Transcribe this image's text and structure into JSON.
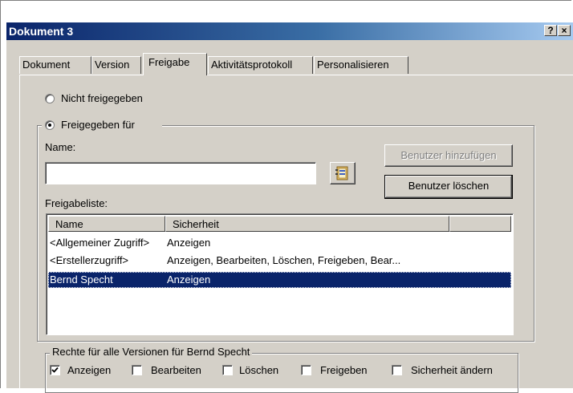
{
  "window": {
    "title": "Dokument 3",
    "help_button": "?",
    "close_button": "×"
  },
  "tabs": [
    {
      "label": "Dokument"
    },
    {
      "label": "Version"
    },
    {
      "label": "Freigabe",
      "active": true
    },
    {
      "label": "Aktivitätsprotokoll"
    },
    {
      "label": "Personalisieren"
    }
  ],
  "sharing": {
    "not_shared_label": "Nicht freigegeben",
    "shared_for_label": "Freigegeben für",
    "selected_option": "Freigegeben für",
    "name_label": "Name:",
    "name_value": "",
    "add_user_button": "Benutzer hinzufügen",
    "remove_user_button": "Benutzer löschen",
    "share_list_label": "Freigabeliste:",
    "list_columns": [
      "Name",
      "Sicherheit"
    ],
    "list_rows": [
      {
        "name": "<Allgemeiner Zugriff>",
        "security": "Anzeigen"
      },
      {
        "name": "<Erstellerzugriff>",
        "security": "Anzeigen, Bearbeiten, Löschen, Freigeben, Bear..."
      },
      {
        "name": "Bernd Specht",
        "security": "Anzeigen",
        "selected": true
      }
    ]
  },
  "rights": {
    "group_title": "Rechte für alle Versionen für Bernd Specht",
    "items": [
      {
        "label": "Anzeigen",
        "checked": true
      },
      {
        "label": "Bearbeiten",
        "checked": false
      },
      {
        "label": "Löschen",
        "checked": false
      },
      {
        "label": "Freigeben",
        "checked": false
      },
      {
        "label": "Sicherheit ändern",
        "checked": false
      }
    ]
  },
  "colors": {
    "title_gradient_start": "#0a246a",
    "title_gradient_end": "#a6caf0",
    "dialog_face": "#d4d0c8",
    "selection": "#0a246a"
  }
}
